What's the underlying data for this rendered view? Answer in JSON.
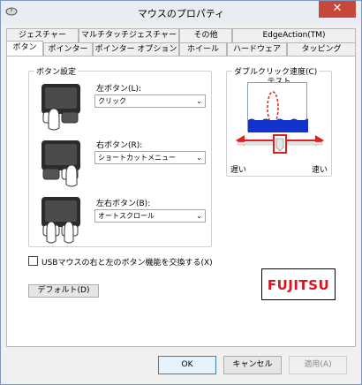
{
  "window": {
    "title": "マウスのプロパティ"
  },
  "tabs": {
    "row1": [
      "ジェスチャー",
      "マルチタッチジェスチャー",
      "その他",
      "EdgeAction(TM)"
    ],
    "row2": [
      "ボタン",
      "ポインター",
      "ポインター オプション",
      "ホイール",
      "ハードウェア",
      "タッピング"
    ]
  },
  "button_settings": {
    "group_label": "ボタン設定",
    "left": {
      "label": "左ボタン(L):",
      "value": "クリック"
    },
    "right": {
      "label": "右ボタン(R):",
      "value": "ショートカットメニュー"
    },
    "both": {
      "label": "左右ボタン(B):",
      "value": "オートスクロール"
    }
  },
  "double_click": {
    "group_label": "ダブルクリック速度(C)",
    "test_label": "テスト",
    "slow_label": "遅い",
    "fast_label": "速い",
    "speed_level": 0.5
  },
  "swap_checkbox": {
    "label": "USBマウスの右と左のボタン機能を交換する(X)",
    "checked": false
  },
  "default_button": "デフォルト(D)",
  "logo_text": "FUJITSU",
  "footer": {
    "ok": "OK",
    "cancel": "キャンセル",
    "apply": "適用(A)"
  },
  "colors": {
    "annotation_red": "#e02020",
    "close_red": "#c7473b",
    "water_blue": "#1133cc"
  }
}
